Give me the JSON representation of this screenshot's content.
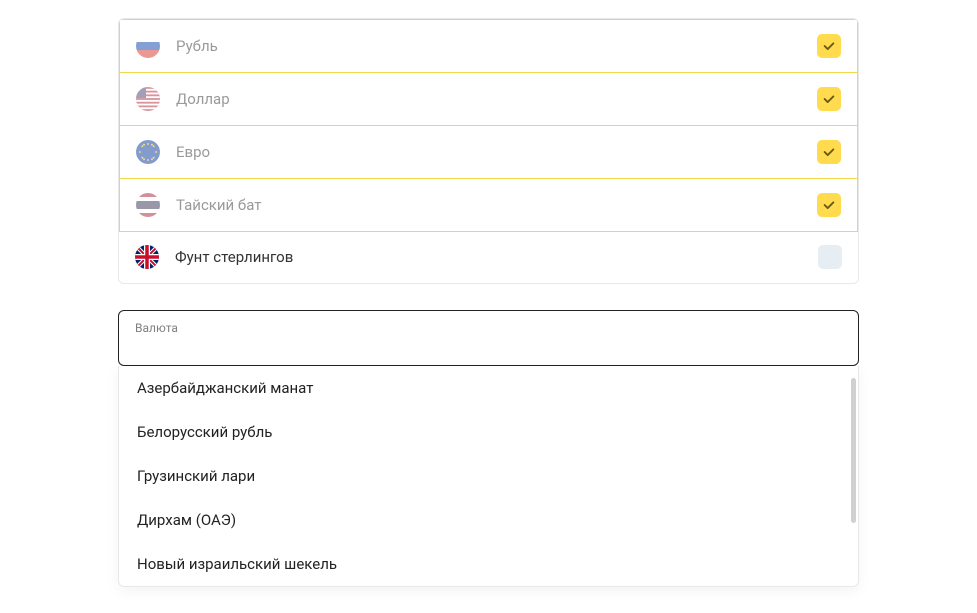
{
  "currencies": [
    {
      "id": "rub",
      "label": "Рубль",
      "selected": true,
      "flag": "ru"
    },
    {
      "id": "usd",
      "label": "Доллар",
      "selected": true,
      "flag": "us"
    },
    {
      "id": "eur",
      "label": "Евро",
      "selected": true,
      "flag": "eu"
    },
    {
      "id": "thb",
      "label": "Тайский бат",
      "selected": true,
      "flag": "th"
    },
    {
      "id": "gbp",
      "label": "Фунт стерлингов",
      "selected": false,
      "flag": "gb"
    }
  ],
  "combobox": {
    "label": "Валюта",
    "value": ""
  },
  "dropdown_options": [
    "Азербайджанский манат",
    "Белорусский рубль",
    "Грузинский лари",
    "Дирхам (ОАЭ)",
    "Новый израильский шекель"
  ]
}
